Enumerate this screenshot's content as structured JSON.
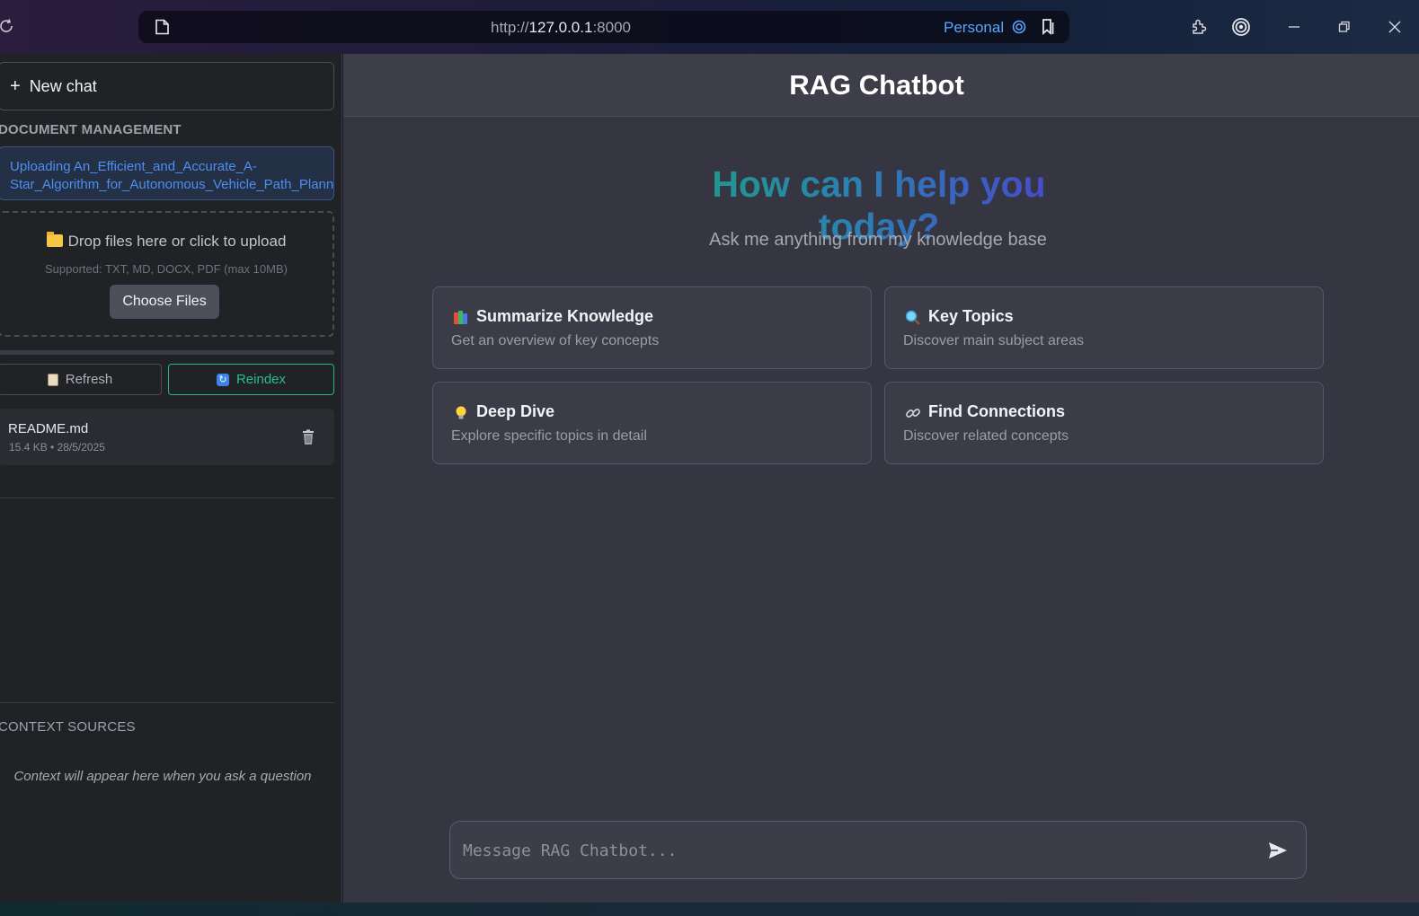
{
  "browser": {
    "url_prefix": "http://",
    "url_host": "127.0.0.1",
    "url_port": ":8000",
    "profile_label": "Personal",
    "icons": [
      "reload-icon",
      "page-icon",
      "profile-icon",
      "bookmark-icon",
      "extensions-icon",
      "copilot-icon",
      "minimize-icon",
      "restore-icon",
      "close-icon"
    ]
  },
  "sidebar": {
    "new_chat_label": "New chat",
    "doc_section_title": "DOCUMENT MANAGEMENT",
    "upload_status_line1": "Uploading An_Efficient_and_Accurate_A-",
    "upload_status_line2": "Star_Algorithm_for_Autonomous_Vehicle_Path_Planning.p",
    "dropzone_text": "Drop files here or click to upload",
    "supported_text": "Supported: TXT, MD, DOCX, PDF (max 10MB)",
    "choose_files_label": "Choose Files",
    "refresh_label": "Refresh",
    "reindex_label": "Reindex",
    "files": [
      {
        "name": "README.md",
        "meta": "15.4 KB • 28/5/2025"
      }
    ],
    "context_section_title": "CONTEXT SOURCES",
    "context_empty_text": "Context will appear here when you ask a question"
  },
  "main": {
    "title": "RAG Chatbot",
    "hero": "How can I help you today?",
    "subtitle": "Ask me anything from my knowledge base",
    "cards": [
      {
        "icon": "books-icon",
        "title": "Summarize Knowledge",
        "desc": "Get an overview of key concepts"
      },
      {
        "icon": "magnifier-icon",
        "title": "Key Topics",
        "desc": "Discover main subject areas"
      },
      {
        "icon": "lightbulb-icon",
        "title": "Deep Dive",
        "desc": "Explore specific topics in detail"
      },
      {
        "icon": "link-icon",
        "title": "Find Connections",
        "desc": "Discover related concepts"
      }
    ],
    "input_placeholder": "Message RAG Chatbot..."
  },
  "colors": {
    "accent_teal": "#24c08f",
    "accent_blue": "#4d8ef0",
    "hero_gradient_start": "#1f9e84",
    "hero_gradient_end": "#4d3fcf"
  }
}
